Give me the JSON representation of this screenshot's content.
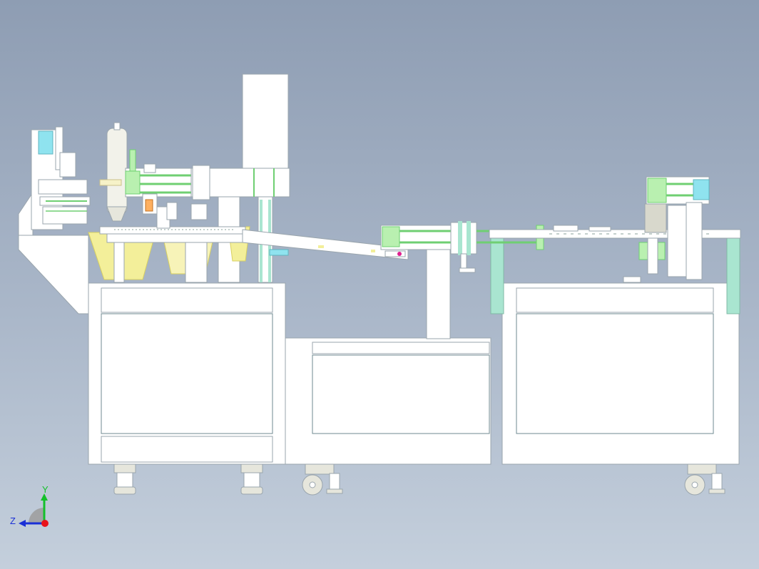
{
  "viewport": {
    "background_top": "#8e9db3",
    "background_bottom": "#c4cfdc"
  },
  "palette": {
    "frame": "#ffffff",
    "outline": "#9aa5ad",
    "panel_line": "#6f8a90",
    "green": "#b9f0b0",
    "green_dark": "#6fcf72",
    "teal": "#a9e5d0",
    "cyan": "#8fe3ef",
    "yellow": "#f3ef9a",
    "yellow_dark": "#d8d060",
    "caster": "#e6e6dc",
    "grey_part": "#d8d8cc",
    "magenta": "#e02090"
  },
  "axis_triad": {
    "y_label": "Y",
    "z_label": "Z",
    "y_color": "#13c02a",
    "z_color": "#1a2fd6",
    "x_dot_color": "#e8121a"
  }
}
